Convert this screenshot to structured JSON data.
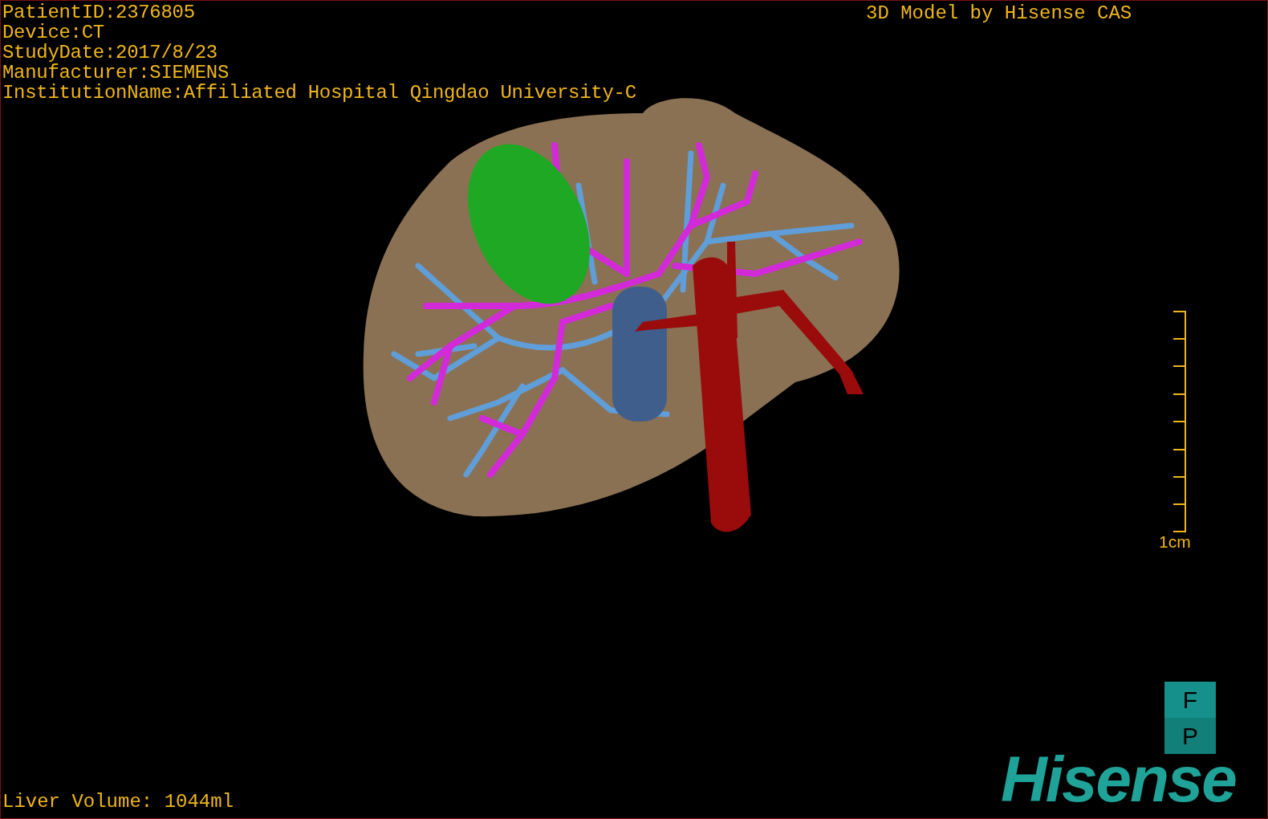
{
  "study_info": [
    "PatientID:2376805",
    "Device:CT",
    "StudyDate:2017/8/23",
    "Manufacturer:SIEMENS",
    "InstitutionName:Affiliated Hospital Qingdao University-C"
  ],
  "caption": "3D Model by Hisense CAS",
  "scale_bar": {
    "label": "1cm"
  },
  "orientation": [
    "F",
    "P"
  ],
  "logo": "Hisense",
  "liver_volume": "Liver Volume: 1044ml"
}
